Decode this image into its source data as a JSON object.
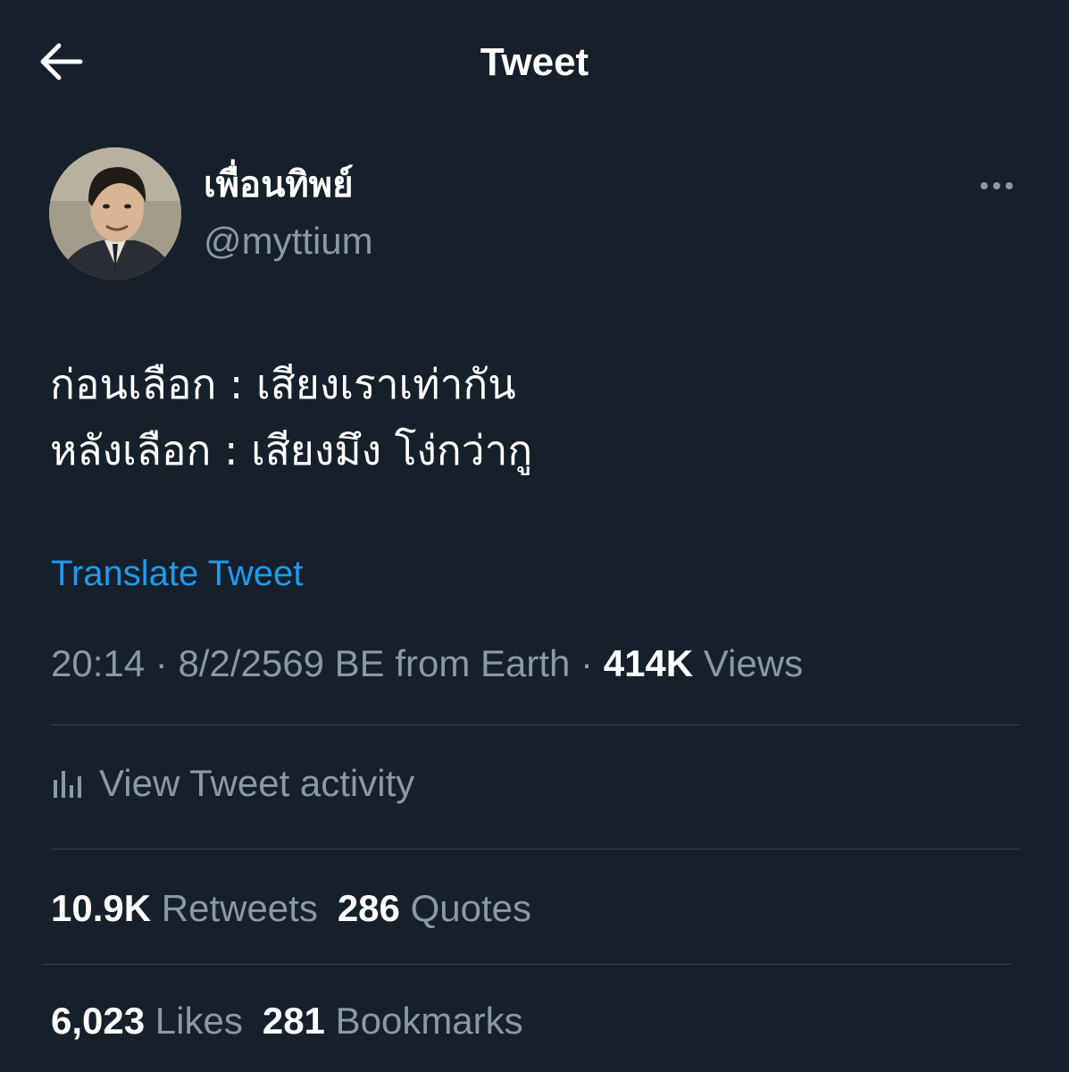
{
  "header": {
    "title": "Tweet",
    "back_icon": "arrow-left-icon"
  },
  "author": {
    "display_name": "เพื่อนทิพย์",
    "handle": "@myttium"
  },
  "tweet": {
    "lines": [
      "ก่อนเลือก : เสียงเราเท่ากัน",
      "หลังเลือก : เสียงมึง โง่กว่ากู"
    ],
    "translate_label": "Translate Tweet"
  },
  "meta": {
    "time": "20:14",
    "date": "8/2/2569 BE",
    "source": "from Earth",
    "separator": "·",
    "views_count": "414K",
    "views_label": "Views"
  },
  "activity": {
    "label": "View Tweet activity",
    "icon": "bar-chart-icon"
  },
  "stats": {
    "retweets_count": "10.9K",
    "retweets_label": "Retweets",
    "quotes_count": "286",
    "quotes_label": "Quotes",
    "likes_count": "6,023",
    "likes_label": "Likes",
    "bookmarks_count": "281",
    "bookmarks_label": "Bookmarks"
  },
  "colors": {
    "background": "#15202b",
    "primary_text": "#ffffff",
    "secondary_text": "#8b98a5",
    "link": "#1d9bf0",
    "divider": "#38444d"
  }
}
